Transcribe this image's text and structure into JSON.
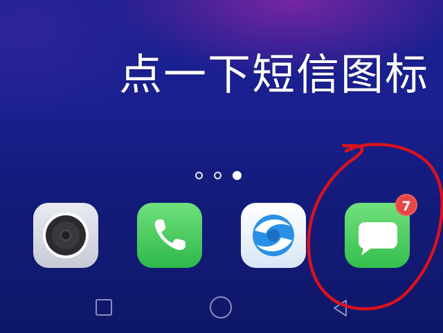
{
  "caption": "点一下短信图标",
  "pager": {
    "count": 3,
    "active_index": 2
  },
  "dock": {
    "apps": [
      {
        "name": "camera",
        "icon": "camera-icon"
      },
      {
        "name": "phone",
        "icon": "phone-handset-icon"
      },
      {
        "name": "browser",
        "icon": "browser-swirl-icon"
      },
      {
        "name": "messages",
        "icon": "message-bubble-icon",
        "badge": "7"
      }
    ]
  },
  "navbar": {
    "buttons": [
      "recent-apps",
      "home",
      "back"
    ]
  },
  "annotation": {
    "type": "hand-drawn circle",
    "color": "#d8121e"
  },
  "colors": {
    "badge": "#e84545",
    "background": "#1a1f8e",
    "messages_green": "#34bf4d"
  }
}
